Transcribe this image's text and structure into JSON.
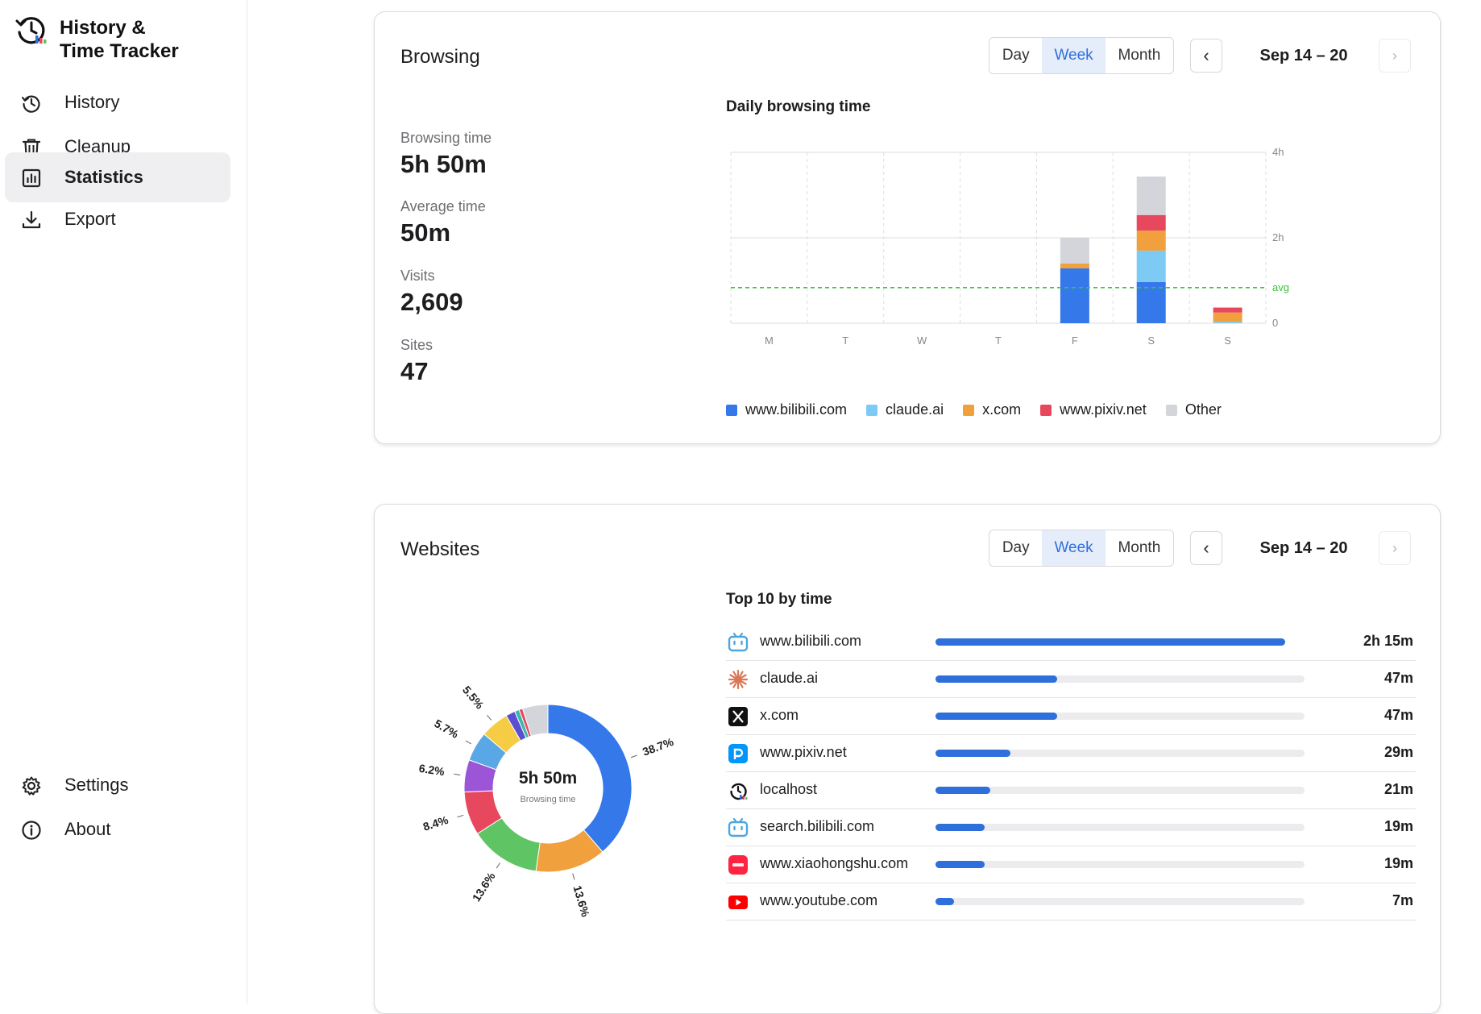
{
  "app": {
    "title": "History  &\nTime Tracker"
  },
  "nav": {
    "items": [
      {
        "label": "History",
        "icon": "history-icon",
        "active": false
      },
      {
        "label": "Cleanup",
        "icon": "trash-icon",
        "active": false
      },
      {
        "label": "Statistics",
        "icon": "chart-icon",
        "active": true
      },
      {
        "label": "Export",
        "icon": "download-icon",
        "active": false
      }
    ],
    "bottom": [
      {
        "label": "Settings",
        "icon": "gear-icon"
      },
      {
        "label": "About",
        "icon": "info-icon"
      }
    ]
  },
  "browsing": {
    "title": "Browsing",
    "period": {
      "day": "Day",
      "week": "Week",
      "month": "Month",
      "selected": "Week"
    },
    "prev": "‹",
    "next": "›",
    "range": "Sep 14 – 20",
    "stats": [
      {
        "label": "Browsing time",
        "value": "5h 50m"
      },
      {
        "label": "Average time",
        "value": "50m"
      },
      {
        "label": "Visits",
        "value": "2,609"
      },
      {
        "label": "Sites",
        "value": "47"
      }
    ]
  },
  "websites": {
    "title": "Websites",
    "period": {
      "day": "Day",
      "week": "Week",
      "month": "Month",
      "selected": "Week"
    },
    "prev": "‹",
    "next": "›",
    "range": "Sep 14 – 20",
    "donut_center": {
      "value": "5h 50m",
      "label": "Browsing time"
    },
    "list_title": "Top 10 by time",
    "top_sites": [
      {
        "site": "www.bilibili.com",
        "duration": "2h 15m",
        "minutes": 135,
        "icon": "bilibili-icon"
      },
      {
        "site": "claude.ai",
        "duration": "47m",
        "minutes": 47,
        "icon": "claude-icon"
      },
      {
        "site": "x.com",
        "duration": "47m",
        "minutes": 47,
        "icon": "x-icon"
      },
      {
        "site": "www.pixiv.net",
        "duration": "29m",
        "minutes": 29,
        "icon": "pixiv-icon"
      },
      {
        "site": "localhost",
        "duration": "21m",
        "minutes": 21,
        "icon": "localhost-icon"
      },
      {
        "site": "search.bilibili.com",
        "duration": "19m",
        "minutes": 19,
        "icon": "bilibili-icon"
      },
      {
        "site": "www.xiaohongshu.com",
        "duration": "19m",
        "minutes": 19,
        "icon": "xiaohongshu-icon"
      },
      {
        "site": "www.youtube.com",
        "duration": "7m",
        "minutes": 7,
        "icon": "youtube-icon"
      }
    ]
  },
  "colors": {
    "accent": "#2f6fdc",
    "active_nav": "#efeff1",
    "avg_line": "#3ac43a"
  },
  "chart_data": [
    {
      "type": "bar",
      "stacked": true,
      "title": "Daily browsing time",
      "categories": [
        "M",
        "T",
        "W",
        "T",
        "F",
        "S",
        "S"
      ],
      "y_unit": "minutes",
      "ylim": [
        0,
        240
      ],
      "yticks": [
        {
          "value": 0,
          "label": "0"
        },
        {
          "value": 120,
          "label": "2h"
        },
        {
          "value": 240,
          "label": "4h"
        }
      ],
      "avg": {
        "value": 50,
        "label": "avg"
      },
      "grid": true,
      "legend_position": "bottom",
      "series": [
        {
          "name": "www.bilibili.com",
          "color": "#3578ea",
          "values": [
            0,
            0,
            0,
            0,
            77,
            58,
            0
          ]
        },
        {
          "name": "claude.ai",
          "color": "#7dcaf5",
          "values": [
            0,
            0,
            0,
            0,
            0,
            44,
            2
          ]
        },
        {
          "name": "x.com",
          "color": "#f0a03c",
          "values": [
            0,
            0,
            0,
            0,
            7,
            28,
            13
          ]
        },
        {
          "name": "www.pixiv.net",
          "color": "#e8485e",
          "values": [
            0,
            0,
            0,
            0,
            0,
            22,
            7
          ]
        },
        {
          "name": "Other",
          "color": "#d3d5db",
          "values": [
            0,
            0,
            0,
            0,
            36,
            54,
            0
          ]
        }
      ]
    },
    {
      "type": "pie",
      "donut": true,
      "slices": [
        {
          "value": 38.7,
          "color": "#3578ea",
          "label": "38.7%"
        },
        {
          "value": 13.6,
          "color": "#f0a03c",
          "label": "13.6%"
        },
        {
          "value": 13.6,
          "color": "#5fc463",
          "label": "13.6%"
        },
        {
          "value": 8.4,
          "color": "#e8485e",
          "label": "8.4%"
        },
        {
          "value": 6.2,
          "color": "#9b55d6",
          "label": "6.2%"
        },
        {
          "value": 5.7,
          "color": "#5aa7e6",
          "label": "5.7%"
        },
        {
          "value": 5.5,
          "color": "#f7cc45",
          "label": "5.5%"
        },
        {
          "value": 1.8,
          "color": "#5a4fd0",
          "label": ""
        },
        {
          "value": 0.9,
          "color": "#3fb7a8",
          "label": ""
        },
        {
          "value": 0.7,
          "color": "#e8485e",
          "label": ""
        },
        {
          "value": 4.9,
          "color": "#d3d5db",
          "label": ""
        }
      ]
    }
  ]
}
